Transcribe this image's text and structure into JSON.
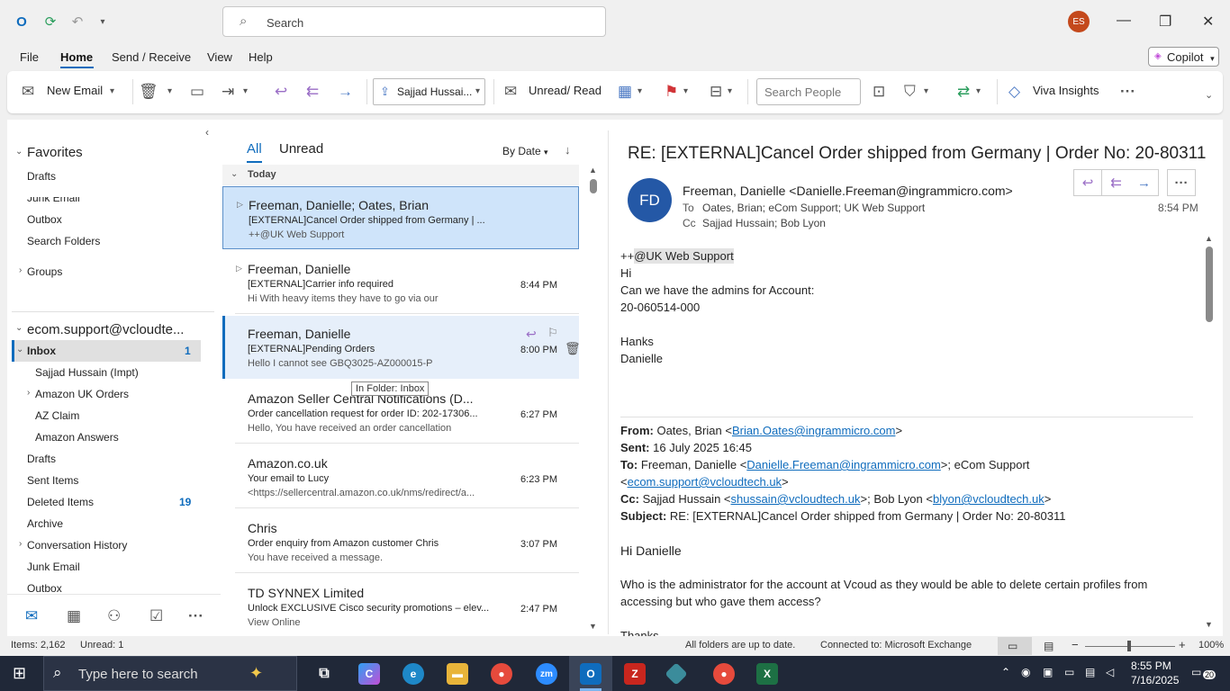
{
  "titlebar": {
    "search_placeholder": "Search",
    "avatar_initials": "ES"
  },
  "menu": {
    "items": [
      "File",
      "Home",
      "Send / Receive",
      "View",
      "Help"
    ],
    "active": "Home",
    "copilot_label": "Copilot"
  },
  "ribbon": {
    "new_email": "New Email",
    "move_to": "Sajjad Hussai...",
    "unread_read": "Unread/ Read",
    "search_people_placeholder": "Search People",
    "viva_insights": "Viva Insights"
  },
  "folders": {
    "favorites_label": "Favorites",
    "favorites": [
      "Drafts",
      "Junk Email",
      "Outbox",
      "Search Folders"
    ],
    "groups_label": "Groups",
    "account": "ecom.support@vcloudte...",
    "inbox": {
      "label": "Inbox",
      "count": "1"
    },
    "inbox_children": [
      "Sajjad Hussain (Impt)",
      "Amazon UK Orders",
      "AZ Claim",
      "Amazon Answers"
    ],
    "drafts": "Drafts",
    "sent": "Sent Items",
    "deleted": {
      "label": "Deleted Items",
      "count": "19"
    },
    "archive": "Archive",
    "conversation_history": "Conversation History",
    "junk": "Junk Email",
    "outbox": "Outbox"
  },
  "list": {
    "tab_all": "All",
    "tab_unread": "Unread",
    "sort": "By Date",
    "group_today": "Today",
    "tooltip": "In Folder: Inbox",
    "messages": [
      {
        "from": "Freeman, Danielle;  Oates, Brian",
        "subject": "[EXTERNAL]Cancel Order shipped from Germany | ...",
        "preview": "++@UK  Web Support",
        "time": ""
      },
      {
        "from": "Freeman, Danielle",
        "subject": "[EXTERNAL]Carrier info required",
        "preview": "Hi  With heavy items they have to go via our",
        "time": "8:44 PM"
      },
      {
        "from": "Freeman, Danielle",
        "subject": "[EXTERNAL]Pending Orders",
        "preview": "Hello  I cannot see  GBQ3025-AZ000015-P",
        "time": "8:00 PM"
      },
      {
        "from": "Amazon Seller Central Notifications (D...",
        "subject": "Order cancellation request for order ID: 202-17306...",
        "preview": "Hello,  You have received an order cancellation",
        "time": "6:27 PM"
      },
      {
        "from": "Amazon.co.uk",
        "subject": "Your email to Lucy",
        "preview": "<https://sellercentral.amazon.co.uk/nms/redirect/a...",
        "time": "6:23 PM"
      },
      {
        "from": "Chris",
        "subject": "Order enquiry from Amazon customer Chris",
        "preview": "You have received a message.",
        "time": "3:07 PM"
      },
      {
        "from": "TD SYNNEX Limited",
        "subject": "Unlock EXCLUSIVE Cisco security promotions – elev...",
        "preview": "View Online",
        "time": "2:47 PM"
      }
    ]
  },
  "reading": {
    "subject": "RE: [EXTERNAL]Cancel Order shipped from Germany | Order No: 20-80311",
    "sender_initials": "FD",
    "sender": "Freeman, Danielle <Danielle.Freeman@ingrammicro.com>",
    "to_label": "To",
    "to": "Oates, Brian; eCom Support; UK  Web Support",
    "cc_label": "Cc",
    "cc": "Sajjad Hussain; Bob Lyon",
    "time": "8:54 PM",
    "body_prefix": "++",
    "body_mention": "@UK  Web Support",
    "body_lines": [
      "Hi",
      "Can we have the admins for Account:",
      "20-060514-000",
      "",
      "Hanks",
      "Danielle"
    ],
    "quoted": {
      "from_label": "From:",
      "from_name": "Oates, Brian <",
      "from_email": "Brian.Oates@ingrammicro.com",
      "sent_label": "Sent:",
      "sent": "16 July 2025 16:45",
      "to_label": "To:",
      "to_name": "Freeman, Danielle <",
      "to_email": "Danielle.Freeman@ingrammicro.com",
      "to_rest": ">; eCom Support",
      "to_email2": "ecom.support@vcloudtech.uk",
      "cc_label": "Cc:",
      "cc_name": "Sajjad Hussain <",
      "cc_email": "shussain@vcloudtech.uk",
      "cc_rest": ">; Bob Lyon <",
      "cc_email2": "blyon@vcloudtech.uk",
      "subject_label": "Subject:",
      "subject": "RE: [EXTERNAL]Cancel Order shipped from Germany | Order No: 20-80311",
      "greeting": "Hi Danielle",
      "para1": "Who is the administrator for the account at Vcoud as they would be able to delete certain profiles from",
      "para2": "accessing but who gave them access?",
      "cut": "Thanks"
    }
  },
  "status": {
    "items": "Items: 2,162",
    "unread": "Unread: 1",
    "sync": "All folders are up to date.",
    "connection": "Connected to: Microsoft Exchange",
    "zoom": "100%"
  },
  "taskbar": {
    "search_placeholder": "Type here to search",
    "time": "8:55 PM",
    "date": "7/16/2025",
    "notifications": "20"
  }
}
